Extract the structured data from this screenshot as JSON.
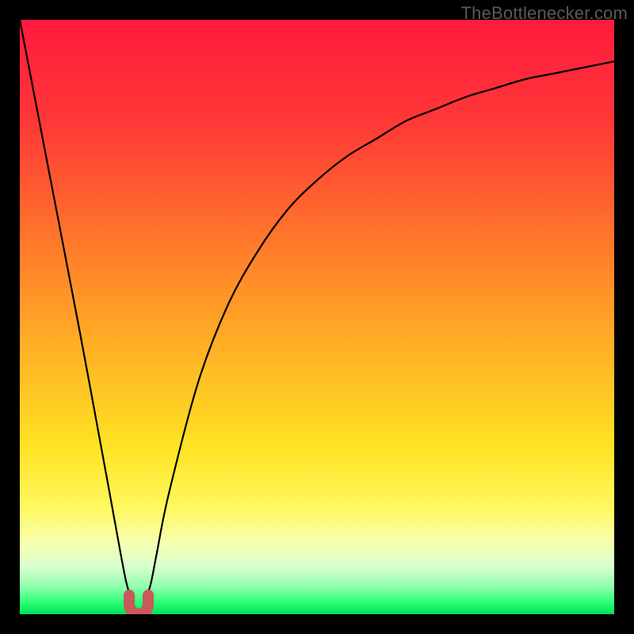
{
  "watermark": "TheBottlenecker.com",
  "chart_data": {
    "type": "line",
    "title": "",
    "xlabel": "",
    "ylabel": "",
    "xlim": [
      0,
      100
    ],
    "ylim": [
      0,
      100
    ],
    "series": [
      {
        "name": "bottleneck-curve",
        "x": [
          0,
          5,
          10,
          15,
          17,
          18,
          19,
          20,
          21,
          22,
          23,
          25,
          30,
          35,
          40,
          45,
          50,
          55,
          60,
          65,
          70,
          75,
          80,
          85,
          90,
          95,
          100
        ],
        "y": [
          100,
          74,
          48,
          21,
          10,
          5,
          2,
          0,
          2,
          5,
          10,
          20,
          39,
          52,
          61,
          68,
          73,
          77,
          80,
          83,
          85,
          87,
          88.5,
          90,
          91,
          92,
          93
        ]
      }
    ],
    "marker": {
      "name": "optimal-point",
      "x": 20,
      "y": 0,
      "color": "#c85a5a"
    },
    "background_gradient": {
      "stops": [
        {
          "offset": 0.0,
          "color": "#ff1a3f"
        },
        {
          "offset": 0.18,
          "color": "#ff3a36"
        },
        {
          "offset": 0.38,
          "color": "#ff7a2a"
        },
        {
          "offset": 0.55,
          "color": "#ffb025"
        },
        {
          "offset": 0.72,
          "color": "#ffe324"
        },
        {
          "offset": 0.82,
          "color": "#fff85e"
        },
        {
          "offset": 0.88,
          "color": "#f6ffb0"
        },
        {
          "offset": 0.92,
          "color": "#d8ffce"
        },
        {
          "offset": 0.955,
          "color": "#8dffad"
        },
        {
          "offset": 0.98,
          "color": "#2bff76"
        },
        {
          "offset": 1.0,
          "color": "#00e05a"
        }
      ]
    }
  }
}
